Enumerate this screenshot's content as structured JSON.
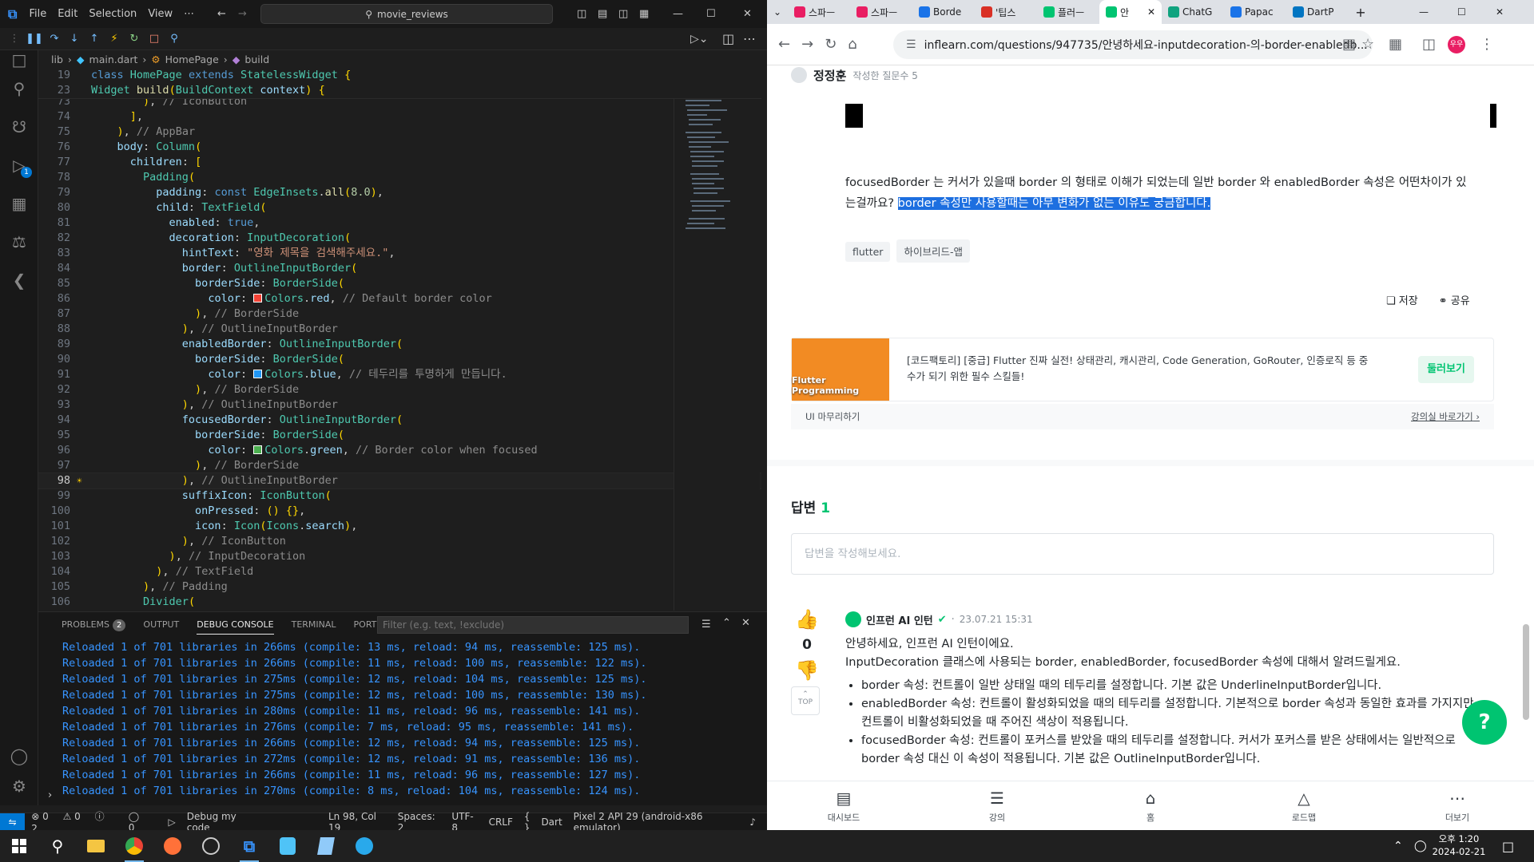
{
  "vscode": {
    "menu": [
      "File",
      "Edit",
      "Selection",
      "View",
      "⋯"
    ],
    "search": "movie_reviews",
    "breadcrumb": {
      "folder": "lib",
      "file": "main.dart",
      "class": "HomePage",
      "method": "build"
    },
    "sticky": [
      {
        "n": "19",
        "code": "class HomePage extends StatelessWidget {"
      },
      {
        "n": "23",
        "code": "Widget build(BuildContext context) {"
      }
    ],
    "code_lines": [
      {
        "n": "73",
        "code": "        ), // IconButton"
      },
      {
        "n": "74",
        "code": "      ],"
      },
      {
        "n": "75",
        "code": "    ), // AppBar"
      },
      {
        "n": "76",
        "code": "    body: Column("
      },
      {
        "n": "77",
        "code": "      children: ["
      },
      {
        "n": "78",
        "code": "        Padding("
      },
      {
        "n": "79",
        "code": "          padding: const EdgeInsets.all(8.0),"
      },
      {
        "n": "80",
        "code": "          child: TextField("
      },
      {
        "n": "81",
        "code": "            enabled: true,"
      },
      {
        "n": "82",
        "code": "            decoration: InputDecoration("
      },
      {
        "n": "83",
        "code": "              hintText: \"영화 제목을 검색해주세요.\","
      },
      {
        "n": "84",
        "code": "              border: OutlineInputBorder("
      },
      {
        "n": "85",
        "code": "                borderSide: BorderSide("
      },
      {
        "n": "86",
        "code": "                  color: Colors.red, // Default border color"
      },
      {
        "n": "87",
        "code": "                ), // BorderSide"
      },
      {
        "n": "88",
        "code": "              ), // OutlineInputBorder"
      },
      {
        "n": "89",
        "code": "              enabledBorder: OutlineInputBorder("
      },
      {
        "n": "90",
        "code": "                borderSide: BorderSide("
      },
      {
        "n": "91",
        "code": "                  color: Colors.blue, // 테두리를 투명하게 만듭니다."
      },
      {
        "n": "92",
        "code": "                ), // BorderSide"
      },
      {
        "n": "93",
        "code": "              ), // OutlineInputBorder"
      },
      {
        "n": "94",
        "code": "              focusedBorder: OutlineInputBorder("
      },
      {
        "n": "95",
        "code": "                borderSide: BorderSide("
      },
      {
        "n": "96",
        "code": "                  color: Colors.green, // Border color when focused"
      },
      {
        "n": "97",
        "code": "                ), // BorderSide"
      },
      {
        "n": "98",
        "code": "              ), // OutlineInputBorder"
      },
      {
        "n": "99",
        "code": "              suffixIcon: IconButton("
      },
      {
        "n": "100",
        "code": "                onPressed: () {},"
      },
      {
        "n": "101",
        "code": "                icon: Icon(Icons.search),"
      },
      {
        "n": "102",
        "code": "              ), // IconButton"
      },
      {
        "n": "103",
        "code": "            ), // InputDecoration"
      },
      {
        "n": "104",
        "code": "          ), // TextField"
      },
      {
        "n": "105",
        "code": "        ), // Padding"
      },
      {
        "n": "106",
        "code": "        Divider("
      }
    ],
    "swatch_colors": {
      "red": "#f44336",
      "blue": "#2196f3",
      "green": "#4caf50"
    },
    "panel_tabs": [
      "PROBLEMS",
      "OUTPUT",
      "DEBUG CONSOLE",
      "TERMINAL",
      "PORTS"
    ],
    "problems_count": "2",
    "filter_placeholder": "Filter (e.g. text, !exclude)",
    "output_lines": [
      "Reloaded 1 of 701 libraries in 266ms (compile: 13 ms, reload: 94 ms, reassemble: 125 ms).",
      "Reloaded 1 of 701 libraries in 266ms (compile: 11 ms, reload: 100 ms, reassemble: 122 ms).",
      "Reloaded 1 of 701 libraries in 275ms (compile: 12 ms, reload: 104 ms, reassemble: 125 ms).",
      "Reloaded 1 of 701 libraries in 275ms (compile: 12 ms, reload: 100 ms, reassemble: 130 ms).",
      "Reloaded 1 of 701 libraries in 280ms (compile: 11 ms, reload: 96 ms, reassemble: 141 ms).",
      "Reloaded 1 of 701 libraries in 276ms (compile: 7 ms, reload: 95 ms, reassemble: 141 ms).",
      "Reloaded 1 of 701 libraries in 266ms (compile: 12 ms, reload: 94 ms, reassemble: 125 ms).",
      "Reloaded 1 of 701 libraries in 272ms (compile: 12 ms, reload: 91 ms, reassemble: 136 ms).",
      "Reloaded 1 of 701 libraries in 266ms (compile: 11 ms, reload: 96 ms, reassemble: 127 ms).",
      "Reloaded 1 of 701 libraries in 270ms (compile: 8 ms, reload: 104 ms, reassemble: 124 ms)."
    ],
    "status": {
      "errors": "0",
      "warnings": "0",
      "infos": "2",
      "ports": "0",
      "debug": "Debug my code",
      "position": "Ln 98, Col 19",
      "spaces": "Spaces: 2",
      "encoding": "UTF-8",
      "eol": "CRLF",
      "language": "Dart",
      "device": "Pixel 2 API 29 (android-x86 emulator)"
    }
  },
  "browser": {
    "tabs": [
      "스파ㅡ",
      "스파ㅡ",
      "Borde",
      "'팁스",
      "플러ㅡ",
      "안",
      "ChatG",
      "Papac",
      "DartP"
    ],
    "url": "inflearn.com/questions/947735/안녕하세요-inputdecoration-의-border-enabledb...",
    "author": "정정훈",
    "author_meta": "작성한 질문수 5",
    "question_text": "focusedBorder 는 커서가 있을때 border 의 형태로 이해가 되었는데 일반 border 와 enabledBorder 속성은 어떤차이가 있는걸까요?",
    "question_highlight": "border 속성만 사용할때는 아무 변화가 없는 이유도 궁금합니다.",
    "tags": [
      "flutter",
      "하이브리드-앱"
    ],
    "save_label": "저장",
    "share_label": "공유",
    "course_text": "[코드팩토리] [중급] Flutter 진짜 실전! 상태관리, 캐시관리, Code Generation, GoRouter, 인증로직 등 중수가 되기 위한 필수 스킬들!",
    "course_thumb": "Flutter Programming",
    "course_button": "둘러보기",
    "section": "UI 마무리하기",
    "go_class": "강의실 바로가기",
    "answers_label": "답변",
    "answers_count": "1",
    "answer_placeholder": "답변을 작성해보세요.",
    "answer": {
      "author": "인프런 AI 인턴",
      "date": "23.07.21 15:31",
      "votes": "0",
      "greeting": "안녕하세요, 인프런 AI 인턴이에요.",
      "intro": "InputDecoration 클래스에 사용되는 border, enabledBorder, focusedBorder 속성에 대해서 알려드릴게요.",
      "bullets": [
        "border 속성: 컨트롤이 일반 상태일 때의 테두리를 설정합니다. 기본 값은 UnderlineInputBorder입니다.",
        "enabledBorder 속성: 컨트롤이 활성화되었을 때의 테두리를 설정합니다. 기본적으로 border 속성과 동일한 효과를 가지지만, 컨트롤이 비활성화되었을 때 주어진 색상이 적용됩니다.",
        "focusedBorder 속성: 컨트롤이 포커스를 받았을 때의 테두리를 설정합니다. 커서가 포커스를 받은 상태에서는 일반적으로 border 속성 대신 이 속성이 적용됩니다. 기본 값은 OutlineInputBorder입니다."
      ]
    },
    "top_label": "TOP",
    "bottom_nav": [
      "대시보드",
      "강의",
      "홈",
      "로드맵",
      "더보기"
    ],
    "avatar_text": "우우"
  },
  "taskbar": {
    "time": "오후 1:20",
    "date": "2024-02-21"
  },
  "colors": {
    "inflearn_green": "#00c471",
    "highlight": "#1d6fe0",
    "vs_blue": "#0078d4"
  }
}
